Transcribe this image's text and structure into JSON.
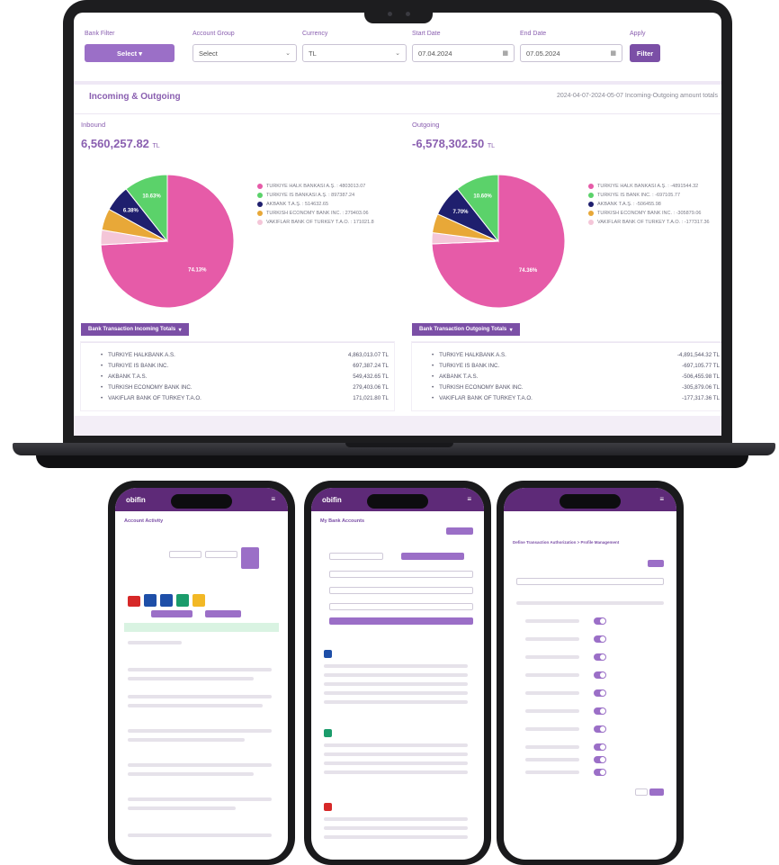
{
  "filters": {
    "bank_filter_label": "Bank Filter",
    "bank_filter_button": "Select",
    "account_group_label": "Account Group",
    "account_group_value": "Select",
    "currency_label": "Currency",
    "currency_value": "TL",
    "start_date_label": "Start Date",
    "start_date_value": "07.04.2024",
    "end_date_label": "End Date",
    "end_date_value": "07.05.2024",
    "apply_label": "Apply",
    "filter_button": "Filter"
  },
  "section": {
    "title": "Incoming & Outgoing",
    "range_text": "2024-04-07-2024-05-07 Incoming-Outgoing amount totals"
  },
  "inbound": {
    "label": "Inbound",
    "total": "6,560,257.82",
    "currency": "TL",
    "totals_tab": "Bank Transaction Incoming Totals",
    "legend": [
      "TURKIYE HALK BANKASI A.Ş. : 4803013.07",
      "TURKIYE IS BANKASI A.Ş. : 897387.24",
      "AKBANK T.A.Ş. : 514632.65",
      "TURKISH ECONOMY BANK INC. : 279403.06",
      "VAKIFLAR BANK OF TURKEY T.A.O. : 171021.8"
    ],
    "totals": [
      {
        "name": "TURKIYE HALKBANK A.S.",
        "value": "4,863,013.07 TL"
      },
      {
        "name": "TURKIYE IS BANK INC.",
        "value": "697,387.24 TL"
      },
      {
        "name": "AKBANK T.A.S.",
        "value": "549,432.65 TL"
      },
      {
        "name": "TURKISH ECONOMY BANK INC.",
        "value": "279,403.06 TL"
      },
      {
        "name": "VAKIFLAR BANK OF TURKEY T.A.O.",
        "value": "171,021.80 TL"
      }
    ],
    "chart_data": {
      "type": "pie",
      "labels": [
        "TURKIYE HALK BANKASI A.Ş.",
        "TURKIYE IS BANKASI A.Ş.",
        "AKBANK T.A.Ş.",
        "TURKISH ECONOMY BANK INC.",
        "VAKIFLAR BANK OF TURKEY T.A.O."
      ],
      "values": [
        74.13,
        10.63,
        6.38,
        5.26,
        3.6
      ],
      "slice_labels": [
        "74.13%",
        "10.63%",
        "6.38%",
        "",
        ""
      ]
    }
  },
  "outgoing": {
    "label": "Outgoing",
    "total": "-6,578,302.50",
    "currency": "TL",
    "totals_tab": "Bank Transaction Outgoing Totals",
    "legend": [
      "TURKIYE HALK BANKASI A.Ş. : -4891544.32",
      "TURKIYE IS BANK INC. : -697105.77",
      "AKBANK T.A.Ş. : -506455.98",
      "TURKISH ECONOMY BANK INC. : -305879.06",
      "VAKIFLAR BANK OF TURKEY T.A.O. : -177317.36"
    ],
    "totals": [
      {
        "name": "TURKIYE HALKBANK A.S.",
        "value": "-4,891,544.32 TL"
      },
      {
        "name": "TURKIYE IS BANK INC.",
        "value": "-697,105.77 TL"
      },
      {
        "name": "AKBANK T.A.S.",
        "value": "-506,455.98 TL"
      },
      {
        "name": "TURKISH ECONOMY BANK INC.",
        "value": "-305,879.06 TL"
      },
      {
        "name": "VAKIFLAR BANK OF TURKEY T.A.O.",
        "value": "-177,317.36 TL"
      }
    ],
    "chart_data": {
      "type": "pie",
      "labels": [
        "TURKIYE HALK BANKASI A.Ş.",
        "TURKIYE IS BANK INC.",
        "AKBANK T.A.Ş.",
        "TURKISH ECONOMY BANK INC.",
        "VAKIFLAR BANK OF TURKEY T.A.O."
      ],
      "values": [
        74.36,
        10.6,
        7.7,
        4.65,
        2.69
      ],
      "slice_labels": [
        "74.36%",
        "10.60%",
        "7.70%",
        "",
        ""
      ]
    }
  },
  "colors": [
    "#e65ba8",
    "#5bd26a",
    "#1f1f6e",
    "#e8a838",
    "#f4c6d8"
  ],
  "phones": {
    "brand": "obifin",
    "menu_icon": "hamburger-icon",
    "phone1_title": "Account Activity",
    "phone2_title": "My Bank Accounts",
    "phone3_title": "Define Transaction Authorization > Profile Management"
  }
}
